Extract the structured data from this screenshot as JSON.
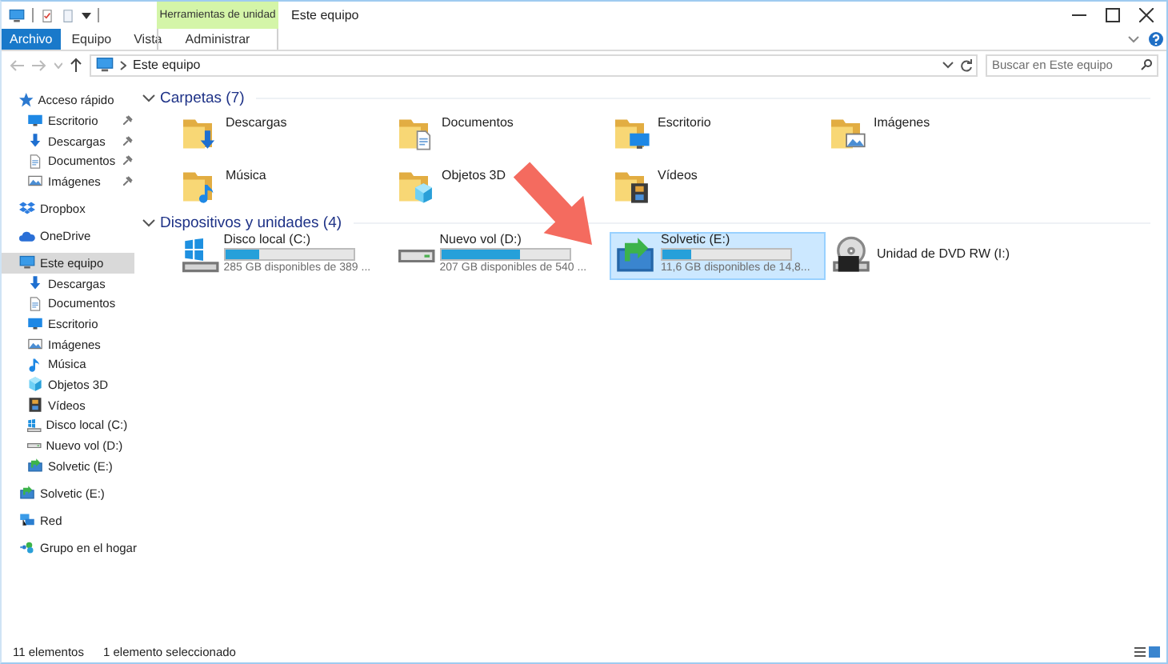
{
  "title_bar": {
    "title": "Este equipo",
    "context_group": "Herramientas de unidad"
  },
  "ribbon_tabs": [
    {
      "label": "Archivo",
      "kind": "file"
    },
    {
      "label": "Equipo",
      "kind": "normal"
    },
    {
      "label": "Vista",
      "kind": "normal"
    },
    {
      "label": "Administrar",
      "kind": "contextual"
    }
  ],
  "address_bar": {
    "path": "Este equipo",
    "search": {
      "placeholder": "Buscar en Este equipo"
    }
  },
  "sidebar": {
    "items": [
      {
        "label": "Acceso rápido",
        "kind": "star",
        "selected": false,
        "children": [
          {
            "label": "Escritorio",
            "kind": "desktop",
            "selected": false,
            "pinned": true
          },
          {
            "label": "Descargas",
            "kind": "download",
            "selected": false,
            "pinned": true
          },
          {
            "label": "Documentos",
            "kind": "document",
            "selected": false,
            "pinned": true
          },
          {
            "label": "Imágenes",
            "kind": "picture",
            "selected": false,
            "pinned": true
          }
        ]
      },
      {
        "label": "Dropbox",
        "kind": "package",
        "selected": false
      },
      {
        "label": "OneDrive",
        "kind": "cloud",
        "selected": false
      },
      {
        "label": "Este equipo",
        "kind": "computer",
        "selected": true,
        "children": [
          {
            "label": "Descargas",
            "kind": "download",
            "selected": false
          },
          {
            "label": "Documentos",
            "kind": "document",
            "selected": false
          },
          {
            "label": "Escritorio",
            "kind": "desktop",
            "selected": false
          },
          {
            "label": "Imágenes",
            "kind": "picture",
            "selected": false
          },
          {
            "label": "Música",
            "kind": "music",
            "selected": false
          },
          {
            "label": "Objetos 3D",
            "kind": "cube",
            "selected": false
          },
          {
            "label": "Vídeos",
            "kind": "film",
            "selected": false
          },
          {
            "label": "Disco local (C:)",
            "kind": "windrive",
            "selected": false
          },
          {
            "label": "Nuevo vol (D:)",
            "kind": "drive",
            "selected": false
          },
          {
            "label": "Solvetic (E:)",
            "kind": "usb",
            "selected": false
          }
        ]
      },
      {
        "label": "Solvetic (E:)",
        "kind": "usb",
        "selected": false
      },
      {
        "label": "Red",
        "kind": "network",
        "selected": false
      },
      {
        "label": "Grupo en el hogar",
        "kind": "homegroup",
        "selected": false
      }
    ]
  },
  "sections": [
    {
      "title": "Carpetas (7)",
      "kind": "folders",
      "expanded": true,
      "items": [
        {
          "name": "Descargas",
          "kind": "download"
        },
        {
          "name": "Documentos",
          "kind": "document"
        },
        {
          "name": "Escritorio",
          "kind": "desktop"
        },
        {
          "name": "Imágenes",
          "kind": "picture"
        },
        {
          "name": "Música",
          "kind": "music"
        },
        {
          "name": "Objetos 3D",
          "kind": "cube"
        },
        {
          "name": "Vídeos",
          "kind": "film"
        }
      ]
    },
    {
      "title": "Dispositivos y unidades (4)",
      "kind": "drives",
      "expanded": true,
      "items": [
        {
          "name": "Disco local (C:)",
          "kind": "windrive",
          "selected": false,
          "level": 0.27,
          "free": "285 GB disponibles de 389 ..."
        },
        {
          "name": "Nuevo vol (D:)",
          "kind": "drive",
          "selected": false,
          "level": 0.62,
          "free": "207 GB disponibles de 540 ..."
        },
        {
          "name": "Solvetic (E:)",
          "kind": "usb",
          "selected": true,
          "level": 0.22,
          "free": "11,6 GB disponibles de 14,8..."
        },
        {
          "name": "Unidad de DVD RW (I:)",
          "kind": "dvd",
          "selected": false
        }
      ]
    }
  ],
  "status_bar": {
    "count": "11 elementos",
    "selection": "1 elemento seleccionado"
  }
}
